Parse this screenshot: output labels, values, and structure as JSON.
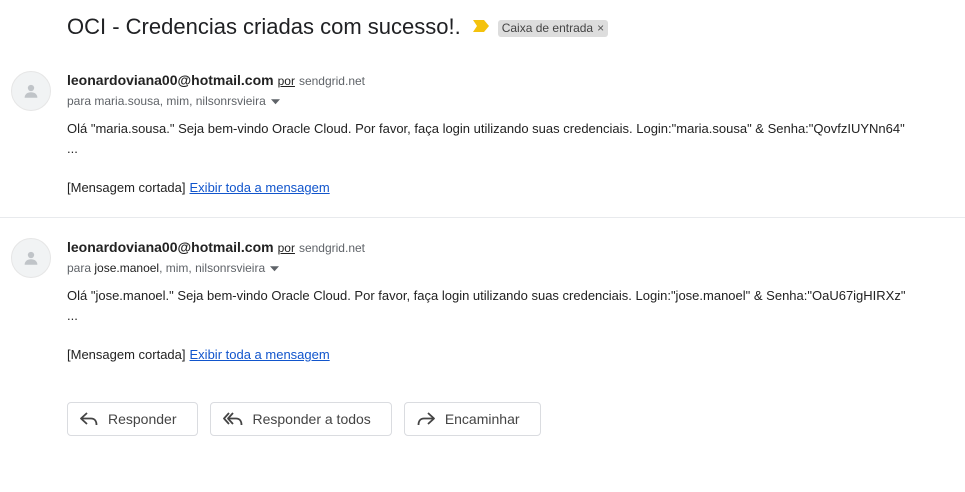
{
  "subject": "OCI - Credencias criadas com sucesso!.",
  "label": "Caixa de entrada",
  "label_remove": "×",
  "messages": [
    {
      "sender": "leonardoviana00@hotmail.com",
      "via_label": "por",
      "via_domain": "sendgrid.net",
      "to_prefix": "para",
      "to_first": "maria.sousa",
      "to_rest": ", mim, nilsonrsvieira",
      "body": "Olá \"maria.sousa.\" Seja bem-vindo Oracle Cloud. Por favor, faça login utilizando suas credenciais. Login:\"maria.sousa\" & Senha:\"QovfzIUYNn64\"",
      "ellipsis": "...",
      "clipped": "[Mensagem cortada]",
      "view_full": "Exibir toda a mensagem"
    },
    {
      "sender": "leonardoviana00@hotmail.com",
      "via_label": "por",
      "via_domain": "sendgrid.net",
      "to_prefix": "para",
      "to_first": "jose.manoel",
      "to_rest": ", mim, nilsonrsvieira",
      "body": "Olá \"jose.manoel.\" Seja bem-vindo Oracle Cloud. Por favor, faça login utilizando suas credenciais. Login:\"jose.manoel\" & Senha:\"OaU67igHIRXz\"",
      "ellipsis": "...",
      "clipped": "[Mensagem cortada]",
      "view_full": "Exibir toda a mensagem"
    }
  ],
  "actions": {
    "reply": "Responder",
    "reply_all": "Responder a todos",
    "forward": "Encaminhar"
  },
  "icons": {
    "importance": "importance-marker-icon",
    "avatar": "default-avatar-icon",
    "caret": "caret-down-icon",
    "reply": "reply-icon",
    "reply_all": "reply-all-icon",
    "forward": "forward-icon"
  },
  "colors": {
    "link": "#1155cc",
    "importance": "#f4c20d",
    "label_bg": "#dddddd"
  }
}
